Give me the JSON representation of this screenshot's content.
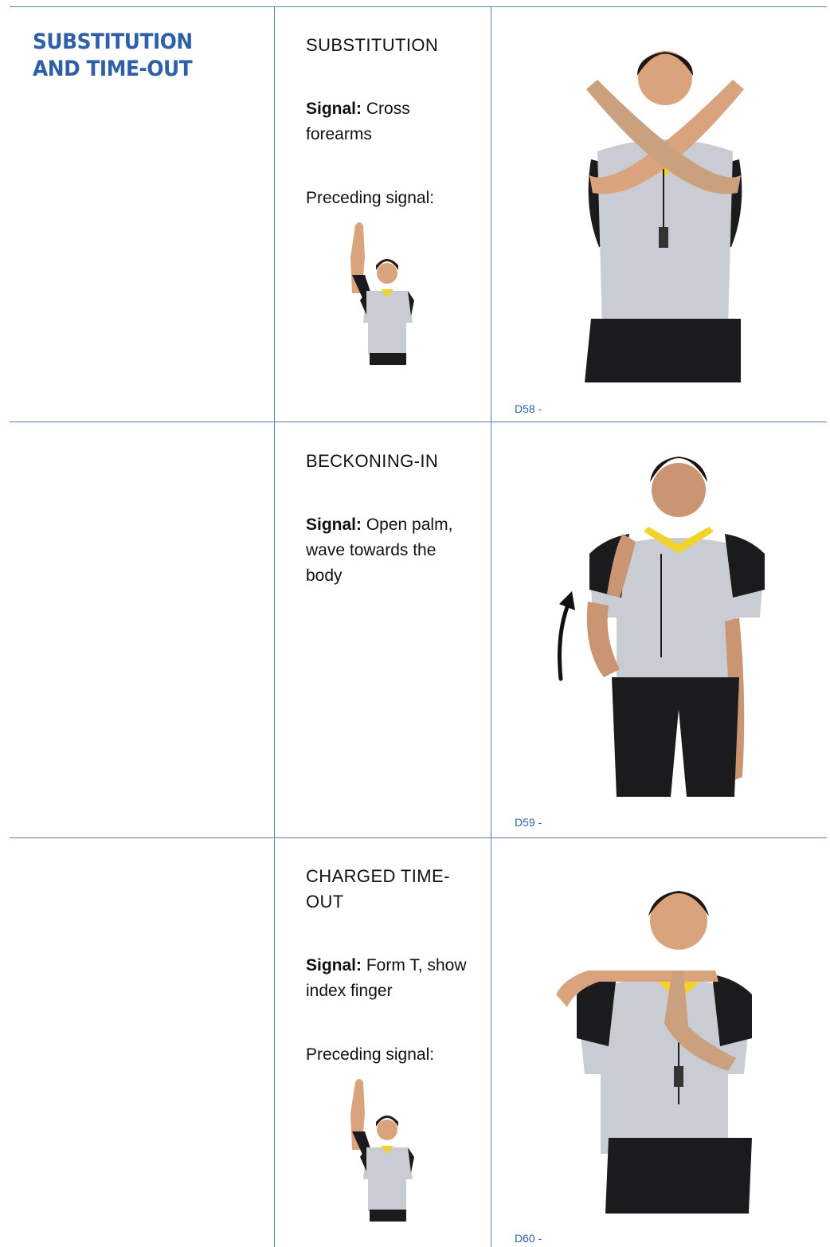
{
  "section_title_line1": "SUBSTITUTION",
  "section_title_line2": "AND TIME-OUT",
  "signals": [
    {
      "name": "SUBSTITUTION",
      "signal_label": "Signal:",
      "signal_text": " Cross forearms",
      "preceding_label": "Preceding signal:",
      "code": "D58 -"
    },
    {
      "name": "BECKONING-IN",
      "signal_label": "Signal:",
      "signal_text": " Open palm, wave towards the body",
      "code": "D59 -"
    },
    {
      "name": "CHARGED TIME-OUT",
      "signal_label": "Signal:",
      "signal_text": " Form T, show index finger",
      "preceding_label": "Preceding signal:",
      "code": "D60 -"
    }
  ],
  "colors": {
    "accent": "#2e5fa7",
    "rule": "#5b7fb5",
    "shirt": "#c9ccd2",
    "trim": "#f2d22c",
    "dark": "#1b1b1d",
    "skin": "#d9a47d"
  }
}
